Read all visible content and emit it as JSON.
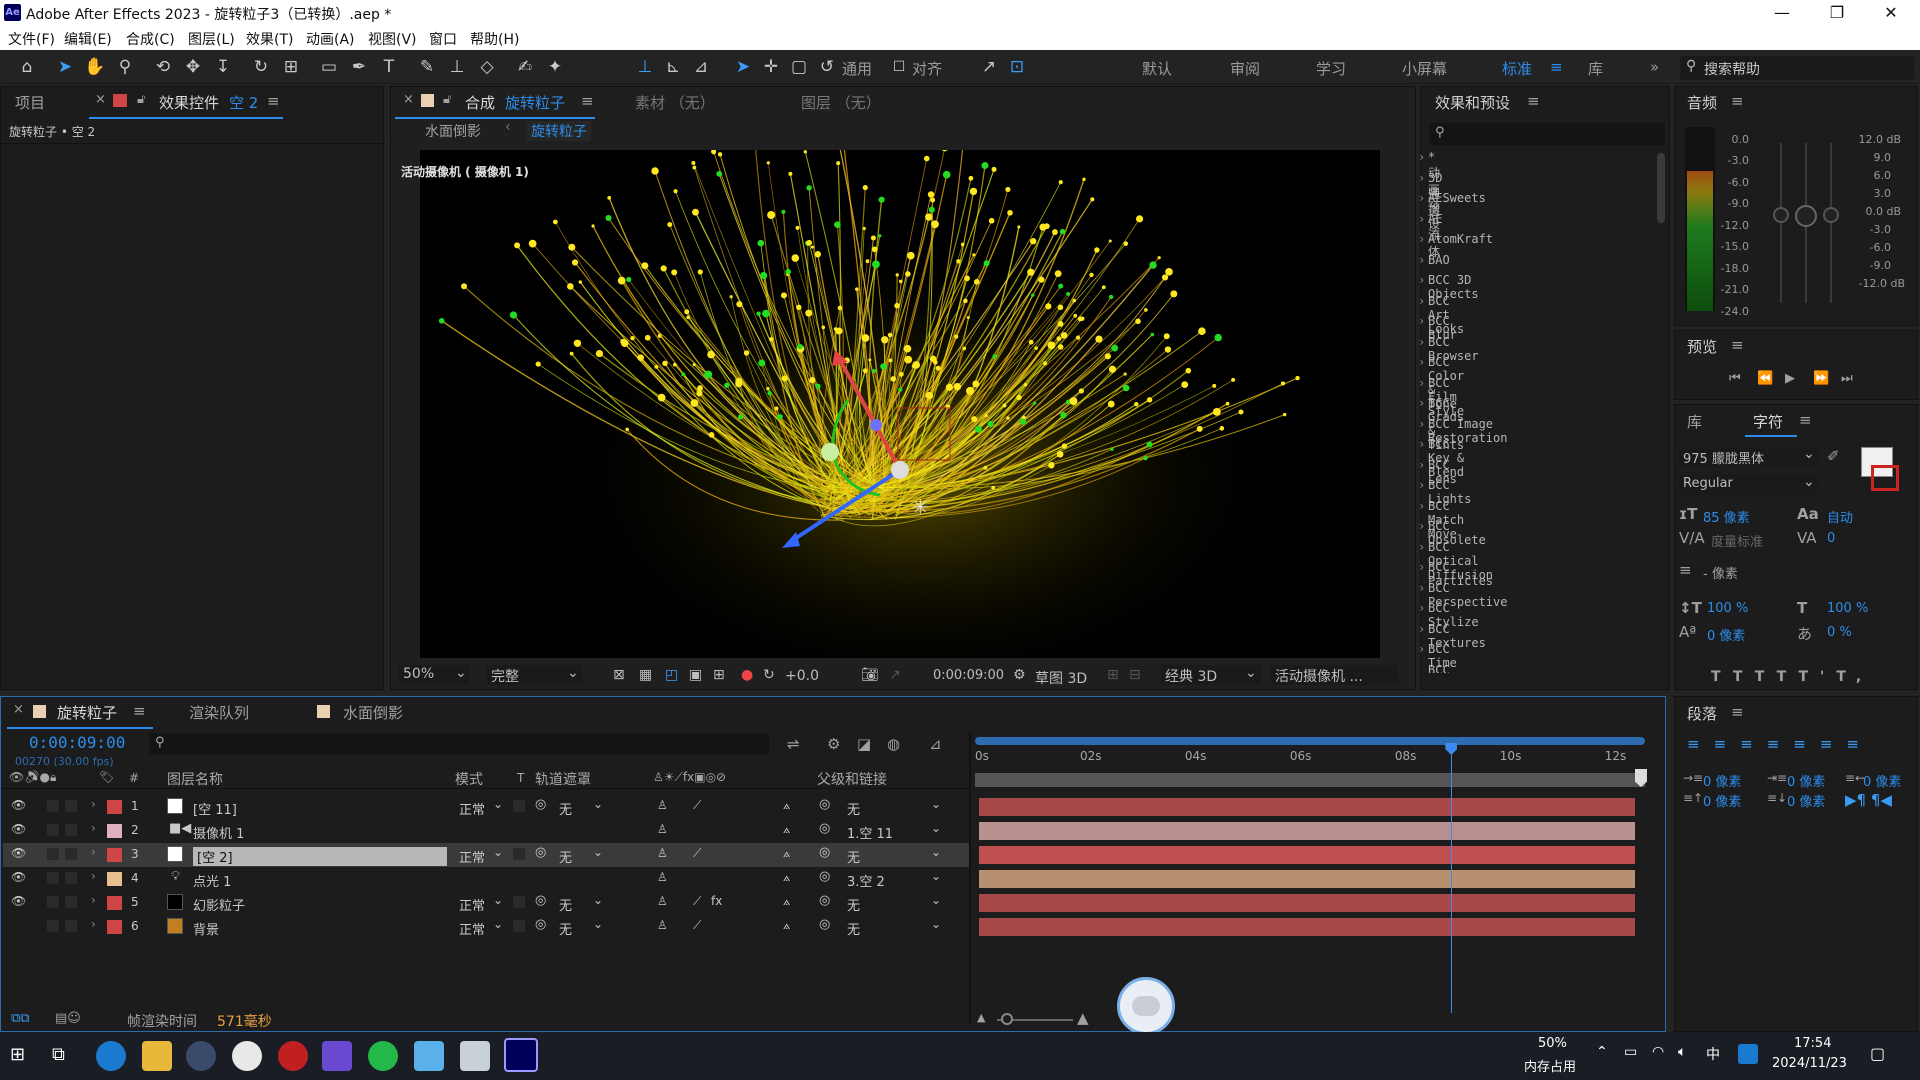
{
  "window": {
    "title": "Adobe After Effects 2023 - 旋转粒子3（已转换）.aep *",
    "app_badge": "Ae",
    "minimize": "—",
    "maximize": "❐",
    "close": "✕"
  },
  "menu": [
    "文件(F)",
    "编辑(E)",
    "合成(C)",
    "图层(L)",
    "效果(T)",
    "动画(A)",
    "视图(V)",
    "窗口",
    "帮助(H)"
  ],
  "toolbar": {
    "universal_label": "通用",
    "align_label": "对齐",
    "workspaces": [
      "默认",
      "审阅",
      "学习",
      "小屏幕",
      "标准",
      "库"
    ],
    "active_workspace": "标准",
    "more": "»",
    "search_placeholder": "搜索帮助"
  },
  "project_panel": {
    "tab_project": "项目",
    "tab_effects": "效果控件",
    "effects_target": "空 2",
    "breadcrumb": "旋转粒子 • 空 2"
  },
  "comp_panel": {
    "tab_label": "合成",
    "comp_name": "旋转粒子",
    "footage_tab": "素材 （无）",
    "layer_tab": "图层 （无）",
    "nav": [
      "水面倒影",
      "旋转粒子"
    ],
    "camera_label": "活动摄像机 ( 摄像机 1)",
    "zoom": "50%",
    "quality": "完整",
    "exposure": "+0.0",
    "timecode": "0:00:09:00",
    "draft3d": "草图 3D",
    "renderer": "经典 3D",
    "view": "活动摄像机 ..."
  },
  "effects_presets": {
    "title": "效果和预设",
    "items": [
      "* 动画预设",
      "3D 通道",
      "AESweets",
      "AE流体",
      "AtomKraft",
      "BAO",
      "BCC 3D Objects",
      "BCC Art Looks",
      "BCC Blur",
      "BCC Browser",
      "BCC Color & Tone",
      "BCC Film Style",
      "BCC Grads & Tints",
      "BCC Image Restoration",
      "BCC Key & Blend",
      "BCC Lens",
      "BCC Lights",
      "BCC Match Move",
      "BCC Obsolete",
      "BCC Optical Diffusion",
      "BCC Particles",
      "BCC Perspective",
      "BCC Stylize",
      "BCC Textures",
      "BCC Time",
      "BCC Transitions"
    ]
  },
  "audio": {
    "title": "音频",
    "left_scale": [
      "0.0",
      "-3.0",
      "-6.0",
      "-9.0",
      "-12.0",
      "-15.0",
      "-18.0",
      "-21.0",
      "-24.0"
    ],
    "right_scale": [
      "12.0 dB",
      "9.0",
      "6.0",
      "3.0",
      "0.0 dB",
      "-3.0",
      "-6.0",
      "-9.0",
      "-12.0 dB"
    ],
    "level_fraction": 0.78
  },
  "preview": {
    "title": "预览"
  },
  "character": {
    "tab_library": "库",
    "tab_character": "字符",
    "font": "975 朦胧黑体",
    "style": "Regular",
    "size": "85 像素",
    "leading": "自动",
    "kerning": "度量标准",
    "tracking": "0",
    "stroke": "- 像素",
    "vscale": "100 %",
    "hscale": "100 %",
    "baseline": "0 像素",
    "tsume": "0 %",
    "fill_color": "#f0f0f0",
    "stroke_color": "#cc2222"
  },
  "paragraph": {
    "title": "段落",
    "indent_left": "0 像素",
    "indent_first": "0 像素",
    "indent_right": "0 像素",
    "space_before": "0 像素",
    "space_after": "0 像素"
  },
  "timeline": {
    "tabs": [
      "旋转粒子",
      "渲染队列",
      "水面倒影"
    ],
    "timecode": "0:00:09:00",
    "frames": "00270 (30.00 fps)",
    "columns": {
      "layer_name": "图层名称",
      "mode": "模式",
      "t": "T",
      "matte": "轨道遮罩",
      "parent": "父级和链接",
      "num": "#"
    },
    "layers": [
      {
        "num": "1",
        "name": "[空 11]",
        "color": "#d04545",
        "swatch": "#ffffff",
        "mode": "正常",
        "matte": "无",
        "parent": "无",
        "bar": "#a84848"
      },
      {
        "num": "2",
        "name": "摄像机 1",
        "color": "#e0b0c0",
        "swatch": "camera",
        "mode": "",
        "matte": "",
        "parent": "1.空 11",
        "bar": "#b89090"
      },
      {
        "num": "3",
        "name": "[空 2]",
        "color": "#d04545",
        "swatch": "#ffffff",
        "mode": "正常",
        "matte": "无",
        "parent": "无",
        "bar": "#c05050"
      },
      {
        "num": "4",
        "name": "点光 1",
        "color": "#e8c090",
        "swatch": "light",
        "mode": "",
        "matte": "",
        "parent": "3.空 2",
        "bar": "#b89070"
      },
      {
        "num": "5",
        "name": "幻影粒子",
        "color": "#d04545",
        "swatch": "#000000",
        "mode": "正常",
        "matte": "无",
        "parent": "无",
        "bar": "#a84848"
      },
      {
        "num": "6",
        "name": "背景",
        "color": "#d04545",
        "swatch": "#c08020",
        "mode": "正常",
        "matte": "无",
        "parent": "无",
        "bar": "#a84848"
      }
    ],
    "ruler": [
      "0s",
      "02s",
      "04s",
      "06s",
      "08s",
      "10s",
      "12s"
    ],
    "current_time_seconds": 9,
    "duration_seconds": 12.5,
    "render_time_label": "帧渲染时间",
    "render_time_value": "571毫秒"
  },
  "taskbar": {
    "memory_percent": "50%",
    "memory_label": "内存占用",
    "ime": "中",
    "time": "17:54",
    "date": "2024/11/23"
  }
}
